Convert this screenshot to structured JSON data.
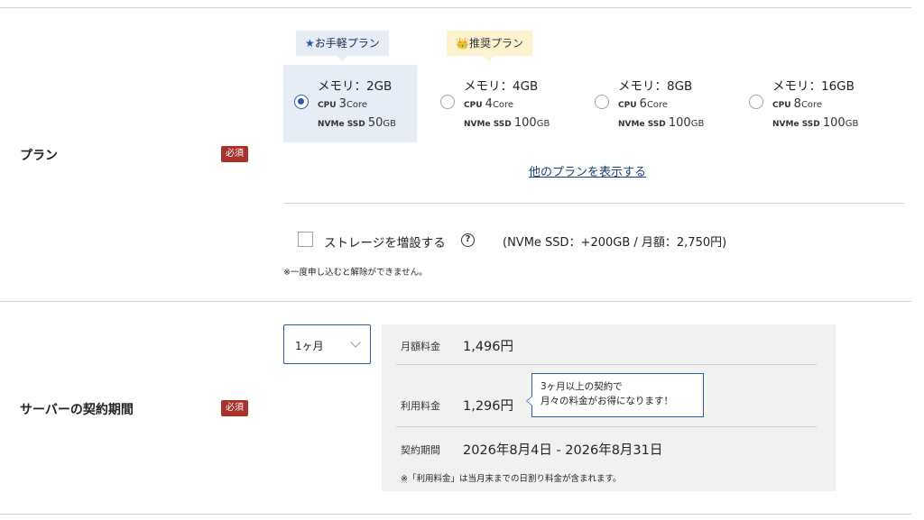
{
  "plan_section": {
    "label": "プラン",
    "required_badge": "必須",
    "tags": [
      {
        "icon": "star-icon",
        "glyph": "★",
        "text": "お手軽プラン"
      },
      {
        "icon": "crown-icon",
        "glyph": "👑",
        "text": "推奨プラン"
      }
    ],
    "plans": [
      {
        "memory": "メモリ：2GB",
        "cpu_label": "CPU",
        "cpu_value": "3",
        "cpu_unit": "Core",
        "ssd_label": "NVMe SSD",
        "ssd_value": "50",
        "ssd_unit": "GB",
        "selected": true
      },
      {
        "memory": "メモリ：4GB",
        "cpu_label": "CPU",
        "cpu_value": "4",
        "cpu_unit": "Core",
        "ssd_label": "NVMe SSD",
        "ssd_value": "100",
        "ssd_unit": "GB",
        "selected": false
      },
      {
        "memory": "メモリ：8GB",
        "cpu_label": "CPU",
        "cpu_value": "6",
        "cpu_unit": "Core",
        "ssd_label": "NVMe SSD",
        "ssd_value": "100",
        "ssd_unit": "GB",
        "selected": false
      },
      {
        "memory": "メモリ：16GB",
        "cpu_label": "CPU",
        "cpu_value": "8",
        "cpu_unit": "Core",
        "ssd_label": "NVMe SSD",
        "ssd_value": "100",
        "ssd_unit": "GB",
        "selected": false
      }
    ],
    "show_other_plans_link": "他のプランを表示する",
    "storage": {
      "checkbox_label": "ストレージを増設する",
      "help_glyph": "?",
      "detail": "(NVMe SSD：+200GB / 月額：2,750円)",
      "checked": false
    },
    "note": "※一度申し込むと解除ができません。"
  },
  "period_section": {
    "label": "サーバーの契約期間",
    "required_badge": "必須",
    "period_select": {
      "value": "1ヶ月"
    },
    "monthly_fee_label": "月額料金",
    "monthly_fee_value": "1,496円",
    "usage_fee_label": "利用料金",
    "usage_fee_value": "1,296円",
    "tooltip_line1": "3ヶ月以上の契約で",
    "tooltip_line2": "月々の料金がお得になります！",
    "contract_period_label": "契約期間",
    "contract_period_value": "2026年8月4日 - 2026年8月31日",
    "note": "※「利用料金」は当月末までの日割り料金が含まれます。"
  },
  "colors": {
    "accent_blue": "#2a5cab",
    "selected_bg": "#e6edf7",
    "required_red": "#a8322b",
    "recommended_bg": "#fdf4cf"
  }
}
